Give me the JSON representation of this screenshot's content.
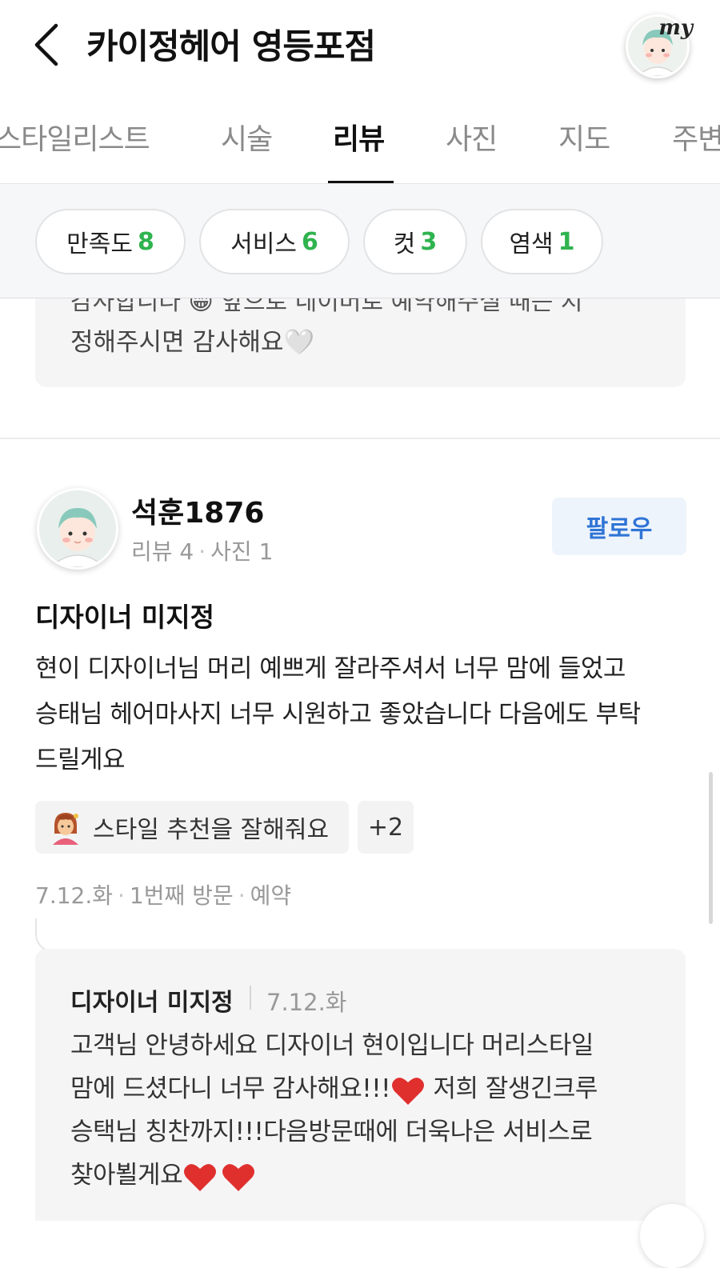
{
  "header": {
    "title": "카이정헤어 영등포점",
    "my_label": "my"
  },
  "tabs": [
    {
      "label": "스타일리스트",
      "active": false
    },
    {
      "label": "시술",
      "active": false
    },
    {
      "label": "리뷰",
      "active": true
    },
    {
      "label": "사진",
      "active": false
    },
    {
      "label": "지도",
      "active": false
    },
    {
      "label": "주변",
      "active": false
    }
  ],
  "filters": [
    {
      "label": "만족도",
      "count": "8"
    },
    {
      "label": "서비스",
      "count": "6"
    },
    {
      "label": "컷",
      "count": "3"
    },
    {
      "label": "염색",
      "count": "1"
    }
  ],
  "previous_review": {
    "cut_line": "감사합니다 😁 앞으로 네이버로 예약해주실 때는 지",
    "last_line": "정해주시면 감사해요🤍"
  },
  "review": {
    "reviewer_name": "석훈1876",
    "review_count_label": "리뷰 4",
    "photo_count_label": "사진 1",
    "follow_label": "팔로우",
    "designer": "디자이너 미지정",
    "text_lines": [
      "현이 디자이너님 머리 예쁘게 잘라주셔서 너무 맘에 들었고",
      "승태님 헤어마사지 너무 시원하고 좋았습니다 다음에도 부탁",
      "드릴게요"
    ],
    "tag_label": "스타일 추천을 잘해줘요",
    "tag_more": "+2",
    "visit_date": "7.12.화",
    "visit_count": "1번째 방문",
    "visit_type": "예약",
    "reply": {
      "author": "디자이너 미지정",
      "date": "7.12.화",
      "line1": "고객님 안녕하세요 디자이너 현이입니다 머리스타일",
      "line2a": "맘에 드셨다니 너무 감사해요!!!",
      "line2b": " 저희 잘생긴크루",
      "line3": "승택님 칭찬까지!!!다음방문때에 더욱나은 서비스로",
      "line4": "찾아뵐게요"
    }
  },
  "colors": {
    "accent_green": "#2fb34f",
    "follow_blue": "#2f74d6",
    "heart_red": "#e0302e"
  }
}
